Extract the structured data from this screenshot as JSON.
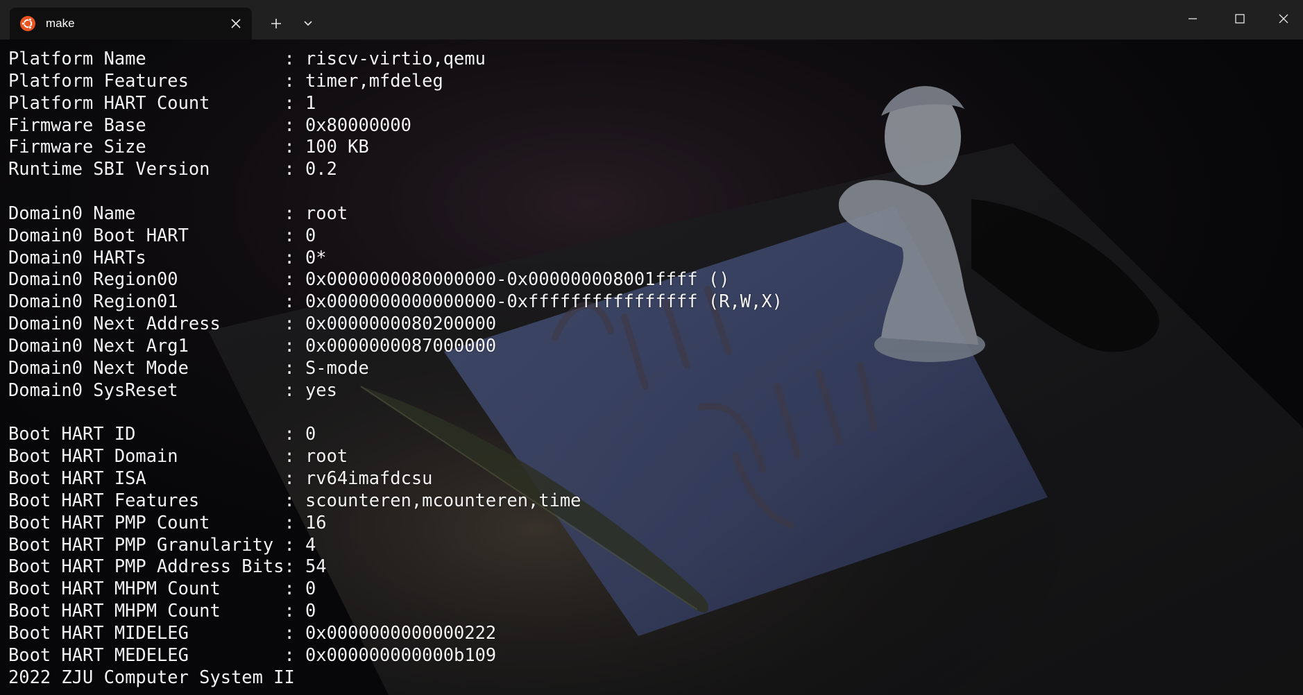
{
  "window": {
    "tab_title": "make",
    "tab_icon": "ubuntu-icon",
    "accent": "#e95420"
  },
  "terminal": {
    "lines": [
      "Platform Name             : riscv-virtio,qemu",
      "Platform Features         : timer,mfdeleg",
      "Platform HART Count       : 1",
      "Firmware Base             : 0x80000000",
      "Firmware Size             : 100 KB",
      "Runtime SBI Version       : 0.2",
      "",
      "Domain0 Name              : root",
      "Domain0 Boot HART         : 0",
      "Domain0 HARTs             : 0*",
      "Domain0 Region00          : 0x0000000080000000-0x000000008001ffff ()",
      "Domain0 Region01          : 0x0000000000000000-0xffffffffffffffff (R,W,X)",
      "Domain0 Next Address      : 0x0000000080200000",
      "Domain0 Next Arg1         : 0x0000000087000000",
      "Domain0 Next Mode         : S-mode",
      "Domain0 SysReset          : yes",
      "",
      "Boot HART ID              : 0",
      "Boot HART Domain          : root",
      "Boot HART ISA             : rv64imafdcsu",
      "Boot HART Features        : scounteren,mcounteren,time",
      "Boot HART PMP Count       : 16",
      "Boot HART PMP Granularity : 4",
      "Boot HART PMP Address Bits: 54",
      "Boot HART MHPM Count      : 0",
      "Boot HART MHPM Count      : 0",
      "Boot HART MIDELEG         : 0x0000000000000222",
      "Boot HART MEDELEG         : 0x000000000000b109",
      "2022 ZJU Computer System II"
    ]
  }
}
